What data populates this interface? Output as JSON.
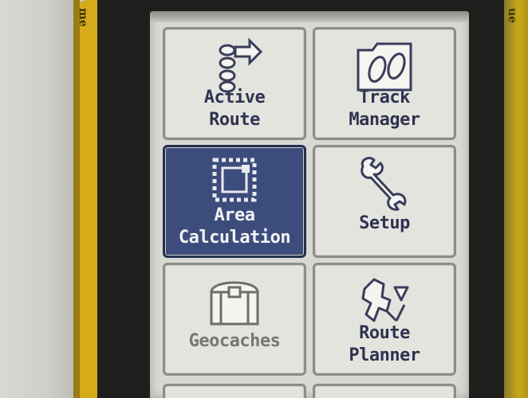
{
  "device": {
    "brand_left_text": "me",
    "brand_right_text": "ue"
  },
  "menu": {
    "tiles": [
      {
        "label_line1": "Active",
        "label_line2": "Route",
        "icon": "route-arrow-icon",
        "selected": false
      },
      {
        "label_line1": "Track",
        "label_line2": "Manager",
        "icon": "footprints-folder-icon",
        "selected": false
      },
      {
        "label_line1": "Area",
        "label_line2": "Calculation",
        "icon": "dotted-square-icon",
        "selected": true
      },
      {
        "label_line1": "Setup",
        "label_line2": "",
        "icon": "wrench-icon",
        "selected": false
      },
      {
        "label_line1": "Geocaches",
        "label_line2": "",
        "icon": "treasure-chest-icon",
        "selected": false
      },
      {
        "label_line1": "Route",
        "label_line2": "Planner",
        "icon": "map-route-icon",
        "selected": false
      }
    ]
  },
  "colors": {
    "screen_bg": "#d9d9d3",
    "tile_bg": "#e4e4df",
    "selected_bg": "#3c4d7d",
    "label_text": "#2f3250",
    "device_yellow": "#d6ab1a"
  }
}
